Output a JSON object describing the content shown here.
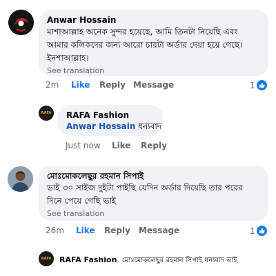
{
  "comments": [
    {
      "author": "Anwar Hossain",
      "text": "মাশাআল্লাহ অনেক সুন্দর হয়েছে, আমি তিনটা নিয়েছি এবং আমার কলিকদের জন্য আরো চারটা অর্ডার দেয়া হয়ে গেছে। ইনশাআল্লাহ।",
      "see_translation": "See translation",
      "time": "2m",
      "like": "Like",
      "reply": "Reply",
      "message": "Message",
      "reactions": "1"
    },
    {
      "author": "মোঃমোকলেছুর রহমান সিপাই",
      "text": "ভাই ৩০ সাইজ দুইটা পাইছি যেদিন অর্ডার দিয়েছি তার পরের দিনে পেয়ে গেছি ভাই",
      "see_translation": "See translation",
      "time": "26m",
      "like": "Like",
      "reply": "Reply",
      "message": "Message",
      "reactions": "1"
    }
  ],
  "replies": [
    {
      "author": "RAFA Fashion",
      "mention": "Anwar Hossain",
      "text": "ধন্যবাদ",
      "time": "Just now",
      "like": "Like",
      "reply": "Reply"
    },
    {
      "author": "RAFA Fashion",
      "mention": "মোঃমোকলেছুর রহমান সিপাই",
      "text": "ধন্যবাদ ভাই"
    }
  ],
  "avatar_text": "RAFA",
  "colors": {
    "accent": "#1877f2",
    "bubble": "#f0f2f5",
    "muted": "#65676b"
  }
}
